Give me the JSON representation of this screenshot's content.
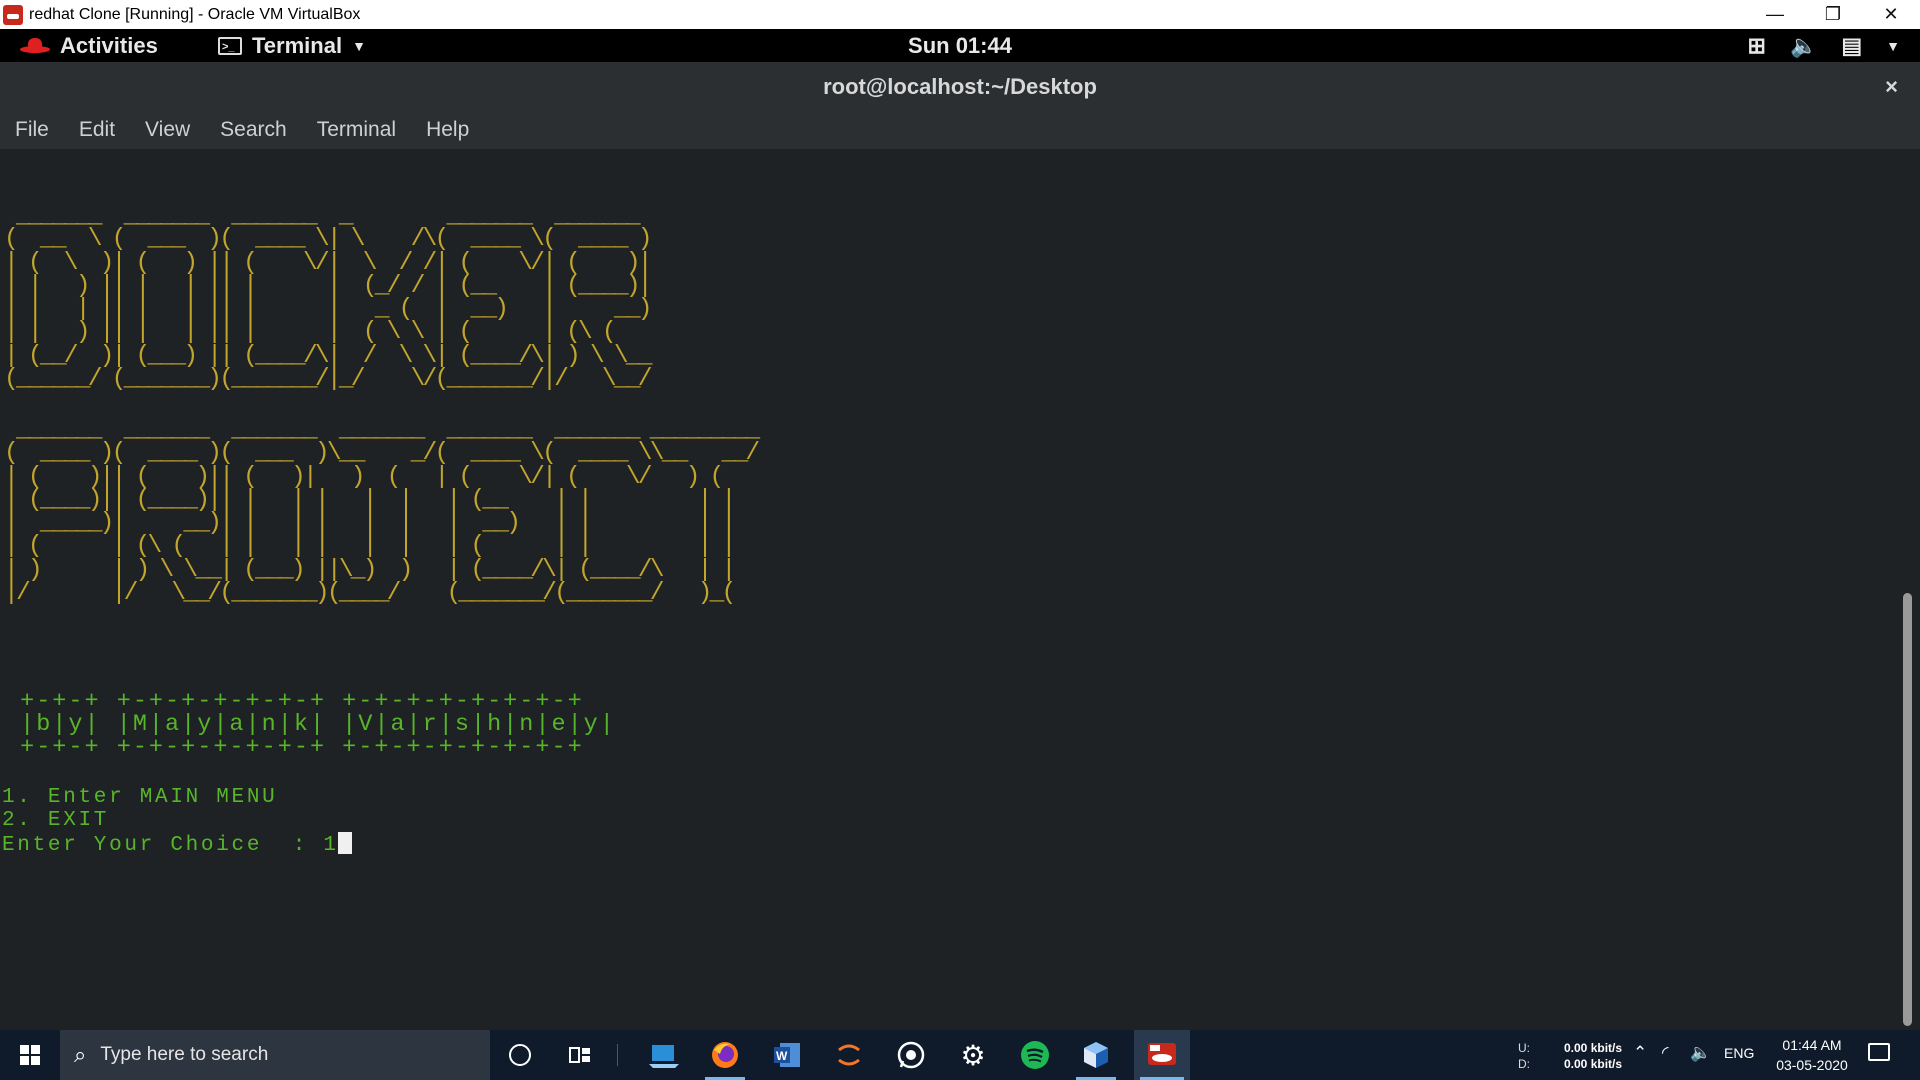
{
  "window": {
    "title": "redhat Clone [Running] - Oracle VM VirtualBox",
    "minimize": "—",
    "restore": "❐",
    "close": "✕"
  },
  "topbar": {
    "activities": "Activities",
    "app_menu": "Terminal",
    "clock": "Sun 01:44"
  },
  "terminal": {
    "title": "root@localhost:~/Desktop",
    "close": "×",
    "menu": [
      "File",
      "Edit",
      "View",
      "Search",
      "Terminal",
      "Help"
    ],
    "banner_docker": " _______  _______  _______  _        _______  _______ \n(  __  \\ (  ___  )(  ____ \\| \\    /\\(  ____ \\(  ____ )\n| (  \\  )| (   ) || (    \\/|  \\  / /| (    \\/| (    )|\n| |   ) || |   | || |      |  (_/ / | (__    | (____)|\n| |   | || |   | || |      |   _ (  |  __)   |     __)\n| |   ) || |   | || |      |  ( \\ \\ | (      | (\\ (   \n| (__/  )| (___) || (____/\\|  /  \\ \\| (____/\\| ) \\ \\__\n(______/ (_______)(_______/|_/    \\/(_______/|/   \\__/",
    "banner_project": " _______  _______  _______  _______  _______  _______ _________\n(  ____ )(  ____ )(  ___  )\\__    _/(  ____ \\(  ____ \\\\__   __/\n| (    )|| (    )|| (   )|   )  (   | (    \\/| (    \\/   ) (   \n| (____)|| (____)|| |   | |   |  |   | (__    | |         | |   \n|  _____)|     __)| |   | |   |  |   |  __)   | |         | |   \n| (      | (\\ (   | |   | |   |  |   | (      | |         | |   \n| )      | ) \\ \\__| (___) ||\\_)  )   | (____/\\| (____/\\   | |   \n|/       |/   \\__/(_______)(____/    (_______/(_______/   )_(   ",
    "byline": " +-+-+ +-+-+-+-+-+-+ +-+-+-+-+-+-+-+\n |b|y| |M|a|y|a|n|k| |V|a|r|s|h|n|e|y|\n +-+-+ +-+-+-+-+-+-+ +-+-+-+-+-+-+-+",
    "option1": "1. Enter MAIN MENU",
    "option2": "2. EXIT",
    "prompt": "Enter Your Choice  : ",
    "input": "1"
  },
  "taskbar": {
    "search_placeholder": "Type here to search",
    "net_up_label": "U:",
    "net_down_label": "D:",
    "net_up": "0.00 kbit/s",
    "net_down": "0.00 kbit/s",
    "language": "ENG",
    "time": "01:44 AM",
    "date": "03-05-2020",
    "apps": [
      "cortana-icon",
      "task-view-icon",
      "files-icon",
      "firefox-icon",
      "word-icon",
      "jupyter-icon",
      "whatsapp-icon",
      "settings-icon",
      "spotify-icon",
      "virtualbox-icon",
      "redhat-vm-icon"
    ]
  },
  "colors": {
    "ascii_banner": "#c2a52c",
    "terminal_text": "#58b52a",
    "terminal_bg": "#1e2224",
    "taskbar_bg": "#0f1b2a"
  }
}
